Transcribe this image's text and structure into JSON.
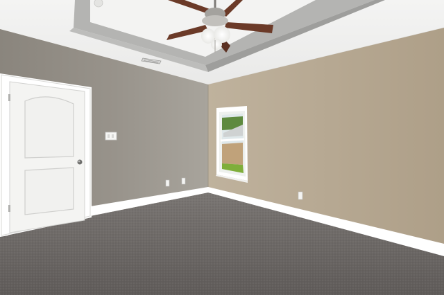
{
  "scene": {
    "kind": "empty-bedroom-interior",
    "elements": [
      "tray-ceiling",
      "ceiling-fan",
      "air-vent",
      "left-wall",
      "right-wall",
      "white-panel-door",
      "light-switch-plate",
      "window",
      "baseboards",
      "outlets",
      "gray-carpet"
    ]
  },
  "colors": {
    "ceiling": "#f2f2f1",
    "tray_soffit": "#a8a8a6",
    "left_wall": "#8f8a82",
    "right_wall": "#b8a992",
    "door": "#f6f6f4",
    "trim": "#ffffff",
    "carpet": "#6c6866",
    "fan_blade": "#6b3a28"
  }
}
